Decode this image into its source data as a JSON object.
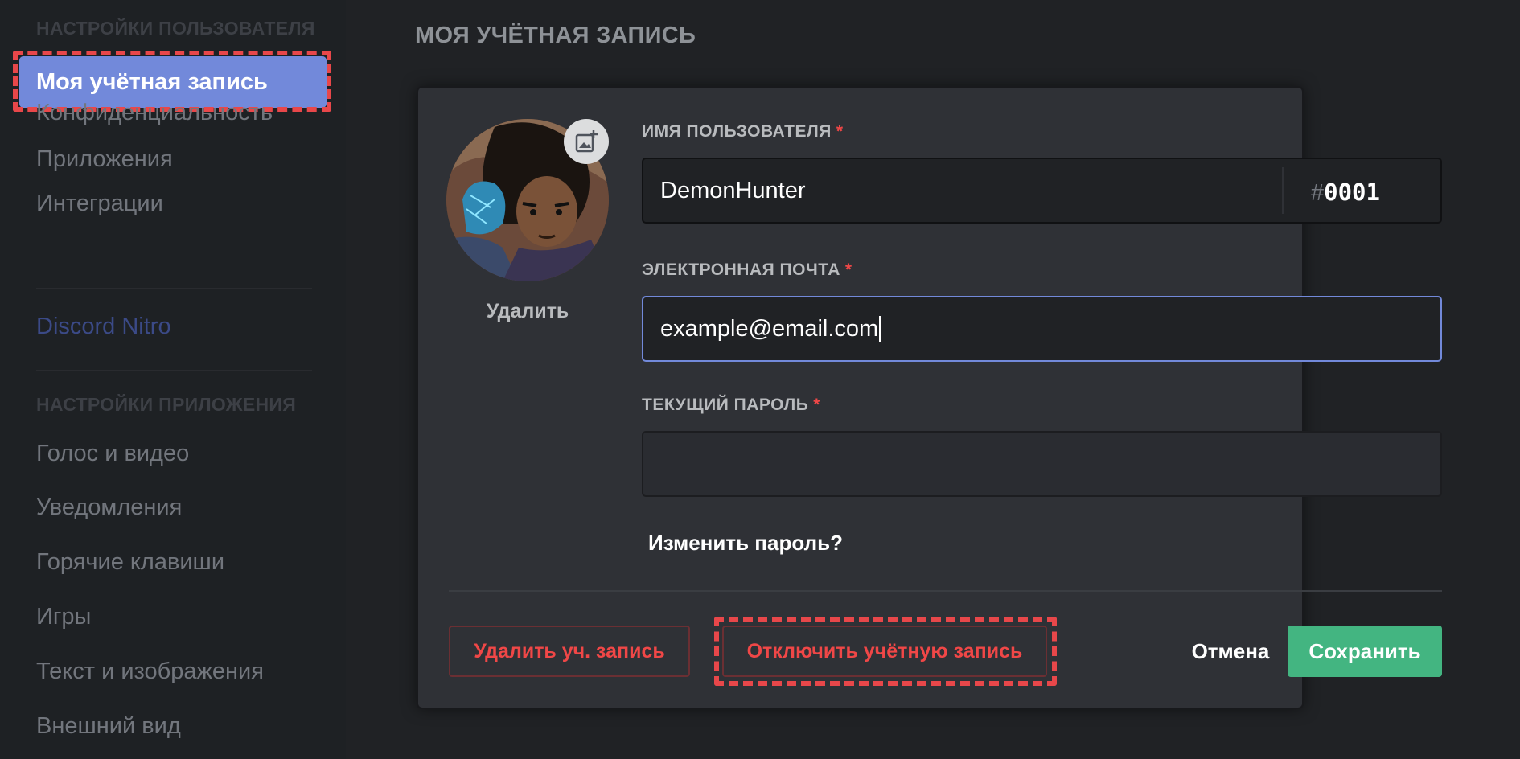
{
  "sidebar": {
    "user_settings_header": "НАСТРОЙКИ ПОЛЬЗОВАТЕЛЯ",
    "user_items": [
      {
        "label": "Моя учётная запись",
        "active": true
      },
      {
        "label": "Конфиденциальность"
      },
      {
        "label": "Приложения"
      },
      {
        "label": "Интеграции"
      }
    ],
    "nitro_label": "Discord Nitro",
    "app_settings_header": "НАСТРОЙКИ ПРИЛОЖЕНИЯ",
    "app_items": [
      {
        "label": "Голос и видео"
      },
      {
        "label": "Уведомления"
      },
      {
        "label": "Горячие клавиши"
      },
      {
        "label": "Игры"
      },
      {
        "label": "Текст и изображения"
      },
      {
        "label": "Внешний вид"
      }
    ]
  },
  "main": {
    "title": "МОЯ УЧЁТНАЯ ЗАПИСЬ",
    "avatar": {
      "remove_label": "Удалить"
    },
    "username": {
      "label": "ИМЯ ПОЛЬЗОВАТЕЛЯ",
      "required_mark": "*",
      "value": "DemonHunter",
      "tag_hash": "#",
      "tag_number": "0001"
    },
    "email": {
      "label": "ЭЛЕКТРОННАЯ ПОЧТА",
      "required_mark": "*",
      "value": "example@email.com"
    },
    "password": {
      "label": "ТЕКУЩИЙ ПАРОЛЬ",
      "required_mark": "*",
      "value": ""
    },
    "change_password_link": "Изменить пароль?",
    "buttons": {
      "delete_account": "Удалить уч. запись",
      "disable_account": "Отключить учётную запись",
      "cancel": "Отмена",
      "save": "Сохранить"
    }
  },
  "colors": {
    "accent": "#7289da",
    "danger": "#f04747",
    "success": "#43b581",
    "highlight": "#e8474a"
  },
  "icons": {
    "avatar_upload": "image-plus-icon"
  }
}
